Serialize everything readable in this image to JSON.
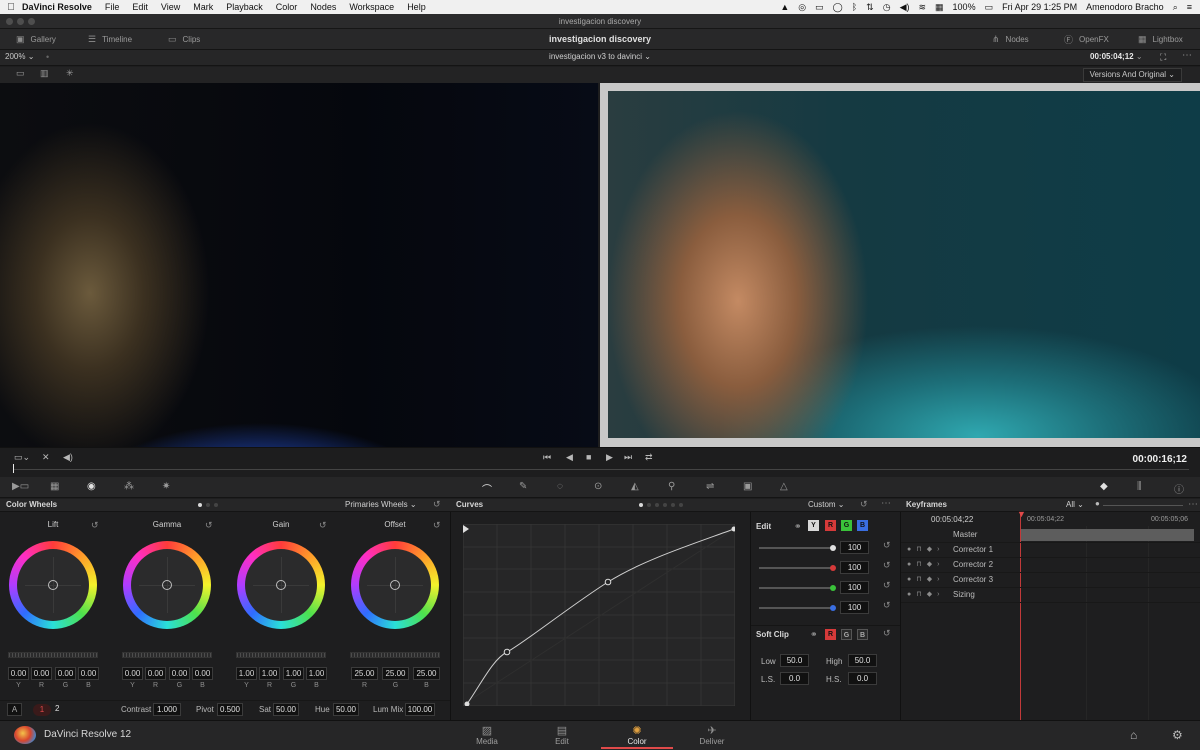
{
  "menubar": {
    "app": "DaVinci Resolve",
    "items": [
      "File",
      "Edit",
      "View",
      "Mark",
      "Playback",
      "Color",
      "Nodes",
      "Workspace",
      "Help"
    ],
    "battery": "100%",
    "datetime": "Fri Apr 29  1:25 PM",
    "user": "Amenodoro Bracho"
  },
  "window": {
    "title": "investigacion discovery"
  },
  "toolbar": {
    "gallery": "Gallery",
    "timeline": "Timeline",
    "clips": "Clips",
    "project": "investigacion discovery",
    "nodes": "Nodes",
    "openfx": "OpenFX",
    "lightbox": "Lightbox"
  },
  "viewer": {
    "zoom": "200%",
    "clip": "investigacion v3 to davinci",
    "timecode_top": "00:05:04;12",
    "versions": "Versions And Original",
    "timecode_main": "00:00:16;12"
  },
  "colorwheels": {
    "title": "Color Wheels",
    "mode": "Primaries Wheels",
    "wheels": [
      {
        "name": "Lift",
        "values": [
          "0.00",
          "0.00",
          "0.00",
          "0.00"
        ],
        "labels": [
          "Y",
          "R",
          "G",
          "B"
        ]
      },
      {
        "name": "Gamma",
        "values": [
          "0.00",
          "0.00",
          "0.00",
          "0.00"
        ],
        "labels": [
          "Y",
          "R",
          "G",
          "B"
        ]
      },
      {
        "name": "Gain",
        "values": [
          "1.00",
          "1.00",
          "1.00",
          "1.00"
        ],
        "labels": [
          "Y",
          "R",
          "G",
          "B"
        ]
      },
      {
        "name": "Offset",
        "values": [
          "25.00",
          "25.00",
          "25.00"
        ],
        "labels": [
          "R",
          "G",
          "B"
        ]
      }
    ],
    "bottom": {
      "a_label": "A",
      "page1": "1",
      "page2": "2",
      "contrast_label": "Contrast",
      "contrast": "1.000",
      "pivot_label": "Pivot",
      "pivot": "0.500",
      "sat_label": "Sat",
      "sat": "50.00",
      "hue_label": "Hue",
      "hue": "50.00",
      "lummix_label": "Lum Mix",
      "lummix": "100.00"
    }
  },
  "curves": {
    "title": "Curves",
    "mode": "Custom",
    "edit_label": "Edit",
    "channels": [
      "Y",
      "R",
      "G",
      "B"
    ],
    "intensities": [
      "100",
      "100",
      "100",
      "100"
    ],
    "channel_colors": [
      "#d8d8d8",
      "#d63a3a",
      "#3ac23a",
      "#3a6ee0"
    ],
    "softclip_label": "Soft Clip",
    "softclip_channels": [
      "R",
      "G",
      "B"
    ],
    "low_label": "Low",
    "low": "50.0",
    "high_label": "High",
    "high": "50.0",
    "ls_label": "L.S.",
    "ls": "0.0",
    "hs_label": "H.S.",
    "hs": "0.0"
  },
  "keyframes": {
    "title": "Keyframes",
    "filter": "All",
    "current_tc": "00:05:04;22",
    "ruler_start": "00:05:04;22",
    "ruler_end": "00:05:05;06",
    "tracks": [
      "Master",
      "Corrector 1",
      "Corrector 2",
      "Corrector 3",
      "Sizing"
    ]
  },
  "pagebar": {
    "brand": "DaVinci Resolve 12",
    "pages": [
      "Media",
      "Edit",
      "Color",
      "Deliver"
    ],
    "active": "Color"
  }
}
